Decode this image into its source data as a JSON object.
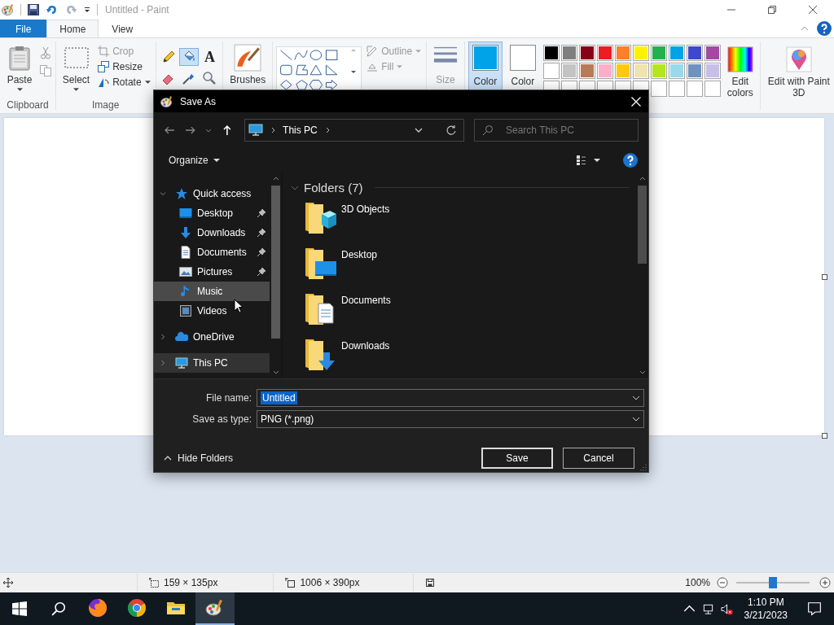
{
  "window": {
    "title": "Untitled - Paint"
  },
  "ribbon_tabs": [
    {
      "label": "File",
      "kind": "file",
      "selected": false
    },
    {
      "label": "Home",
      "kind": "tab",
      "selected": true
    },
    {
      "label": "View",
      "kind": "tab",
      "selected": false
    }
  ],
  "clipboard": {
    "label": "Clipboard",
    "paste": "Paste"
  },
  "image": {
    "label": "Image",
    "select": "Select",
    "commands": [
      {
        "label": "Crop",
        "kind": "crop",
        "disabled": true
      },
      {
        "label": "Resize",
        "kind": "resize",
        "disabled": false
      },
      {
        "label": "Rotate",
        "kind": "rotate",
        "disabled": false
      }
    ]
  },
  "tools": [
    {
      "kind": "pencil",
      "selected": false
    },
    {
      "kind": "fill",
      "selected": true
    },
    {
      "kind": "text",
      "label": "A",
      "selected": false
    },
    {
      "kind": "eraser",
      "selected": false
    },
    {
      "kind": "picker",
      "selected": false
    },
    {
      "kind": "magnifier",
      "selected": false
    }
  ],
  "brushes": {
    "label": "Brushes"
  },
  "shape_options": [
    {
      "label": "Outline",
      "kind": "outline",
      "disabled": true
    },
    {
      "label": "Fill",
      "kind": "fill",
      "disabled": true
    }
  ],
  "size": {
    "label": "Size",
    "disabled": true
  },
  "colors": [
    {
      "label": "Color",
      "color": "#00a2e8",
      "selected": true
    },
    {
      "label": "Color",
      "color": "#ffffff",
      "selected": false
    }
  ],
  "palette": [
    {
      "kind": "swatch",
      "color": "#000000"
    },
    {
      "kind": "swatch",
      "color": "#7f7f7f"
    },
    {
      "kind": "swatch",
      "color": "#880015"
    },
    {
      "kind": "swatch",
      "color": "#ed1c24"
    },
    {
      "kind": "swatch",
      "color": "#ff7f27"
    },
    {
      "kind": "swatch",
      "color": "#fff200"
    },
    {
      "kind": "swatch",
      "color": "#22b14c"
    },
    {
      "kind": "swatch",
      "color": "#00a2e8"
    },
    {
      "kind": "swatch",
      "color": "#3f48cc"
    },
    {
      "kind": "swatch",
      "color": "#a349a4"
    },
    {
      "kind": "swatch",
      "color": "#ffffff"
    },
    {
      "kind": "swatch",
      "color": "#c3c3c3"
    },
    {
      "kind": "swatch",
      "color": "#b97a57"
    },
    {
      "kind": "swatch",
      "color": "#ffaec9"
    },
    {
      "kind": "swatch",
      "color": "#ffc90e"
    },
    {
      "kind": "swatch",
      "color": "#efe4b0"
    },
    {
      "kind": "swatch",
      "color": "#b5e61d"
    },
    {
      "kind": "swatch",
      "color": "#99d9ea"
    },
    {
      "kind": "swatch",
      "color": "#7092be"
    },
    {
      "kind": "swatch",
      "color": "#c8bfe7"
    },
    {
      "kind": "empty"
    },
    {
      "kind": "empty"
    },
    {
      "kind": "empty"
    },
    {
      "kind": "empty"
    },
    {
      "kind": "empty"
    },
    {
      "kind": "empty"
    },
    {
      "kind": "empty"
    },
    {
      "kind": "empty"
    },
    {
      "kind": "empty"
    },
    {
      "kind": "empty"
    }
  ],
  "edit_colors": "Edit colors",
  "paint3d": "Edit with Paint 3D",
  "dialog": {
    "title": "Save As",
    "address": "This PC",
    "search": {
      "placeholder": "Search This PC"
    },
    "organize": "Organize",
    "nav_tree": [
      {
        "label": "Quick access",
        "kind": "star",
        "expanded": true,
        "selected": false,
        "hovered": false,
        "children": [
          {
            "label": "Desktop",
            "kind": "desktop",
            "pinned": true,
            "selected": false,
            "hovered": false
          },
          {
            "label": "Downloads",
            "kind": "download",
            "pinned": true,
            "selected": false,
            "hovered": false
          },
          {
            "label": "Documents",
            "kind": "document",
            "pinned": true,
            "selected": false,
            "hovered": false
          },
          {
            "label": "Pictures",
            "kind": "picture",
            "pinned": true,
            "selected": false,
            "hovered": false
          },
          {
            "label": "Music",
            "kind": "music",
            "pinned": false,
            "selected": false,
            "hovered": true
          },
          {
            "label": "Videos",
            "kind": "video",
            "pinned": false,
            "selected": false,
            "hovered": false
          }
        ]
      },
      {
        "label": "OneDrive",
        "kind": "cloud",
        "expanded": false,
        "selected": false,
        "hovered": false
      },
      {
        "label": "This PC",
        "kind": "computer",
        "expanded": false,
        "selected": true,
        "hovered": false
      }
    ],
    "section": "Folders (7)",
    "folders": [
      {
        "name": "3D Objects",
        "kind": "cube"
      },
      {
        "name": "Desktop",
        "kind": "desktop"
      },
      {
        "name": "Documents",
        "kind": "document"
      },
      {
        "name": "Downloads",
        "kind": "download"
      }
    ],
    "file_name": {
      "label": "File name:",
      "value": "Untitled"
    },
    "save_as_type": {
      "label": "Save as type:",
      "value": "PNG (*.png)"
    },
    "hide_folders": "Hide Folders",
    "buttons": [
      {
        "label": "Save",
        "kind": "default"
      },
      {
        "label": "Cancel",
        "kind": "normal"
      }
    ]
  },
  "status_bar": {
    "selection": "159 × 135px",
    "image_size": "1006 × 390px",
    "zoom": "100%",
    "zoom_slider": {
      "level": 0.5
    }
  },
  "taskbar": {
    "apps": [
      {
        "kind": "firefox",
        "selected": false
      },
      {
        "kind": "chrome",
        "selected": false
      },
      {
        "kind": "explorer",
        "selected": false
      },
      {
        "kind": "paint",
        "selected": true
      }
    ],
    "time": "1:10 PM",
    "date": "3/21/2023"
  }
}
